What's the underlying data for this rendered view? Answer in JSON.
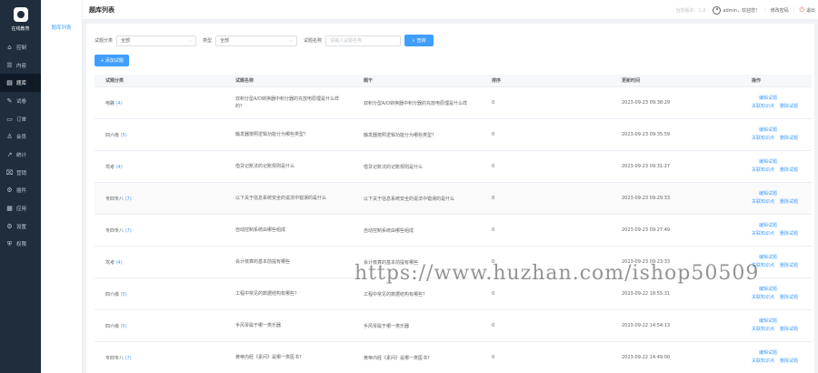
{
  "brand": {
    "name": "在线教育",
    "logo": "logo-icon"
  },
  "sidebar": {
    "items": [
      {
        "label": "控制",
        "icon": "home-icon",
        "glyph": "⌂"
      },
      {
        "label": "内容",
        "icon": "list-icon",
        "glyph": "☰"
      },
      {
        "label": "题库",
        "icon": "book-icon",
        "glyph": "▤",
        "active": true
      },
      {
        "label": "试卷",
        "icon": "exam-icon",
        "glyph": "✎"
      },
      {
        "label": "订单",
        "icon": "order-icon",
        "glyph": "▭"
      },
      {
        "label": "会员",
        "icon": "user-icon",
        "glyph": "♙"
      },
      {
        "label": "统计",
        "icon": "chart-icon",
        "glyph": "↗"
      },
      {
        "label": "营销",
        "icon": "shop-icon",
        "glyph": "⌧"
      },
      {
        "label": "插件",
        "icon": "plugin-icon",
        "glyph": "⚙"
      },
      {
        "label": "应用",
        "icon": "app-icon",
        "glyph": "▦"
      },
      {
        "label": "设置",
        "icon": "settings-icon",
        "glyph": "⚙"
      },
      {
        "label": "权限",
        "icon": "shield-icon",
        "glyph": "⛨"
      }
    ]
  },
  "submenu": {
    "active_item": "题库列表"
  },
  "header": {
    "title": "题库列表",
    "version": "当前版本：1.0",
    "greeting": "admin，欢迎您！",
    "change_password": "修改密码",
    "logout": "退出"
  },
  "filters": {
    "category_label": "试题分类",
    "category_value": "全部",
    "type_label": "类型",
    "type_value": "全部",
    "name_label": "试题名称",
    "name_placeholder": "请输入试题名称",
    "search_button": "查询"
  },
  "add_button": "+ 添加试题",
  "table": {
    "columns": [
      "试题分类",
      "试题名称",
      "题干",
      "排序",
      "更新时间",
      "操作"
    ],
    "ops": {
      "edit": "编辑试题",
      "related": "关联知识点",
      "delete": "删除试题"
    },
    "rows": [
      {
        "category": "电路",
        "count": "(4)",
        "name": "双积分型A/D转换器中积分器的充放电原理是什么样的？",
        "stem": "双积分型A/D转换器中积分器的充放电原理是什么样",
        "sort": "0",
        "time": "2023-09-23 09:38:29"
      },
      {
        "category": "四六级",
        "count": "(5)",
        "name": "触发器按照逻辑功能分为哪些类型？",
        "stem": "触发器按照逻辑功能分为哪些类型？",
        "sort": "0",
        "time": "2023-09-23 09:35:59"
      },
      {
        "category": "驾考",
        "count": "(4)",
        "name": "借贷记账法的记账规则是什么",
        "stem": "借贷记账法的记账规则是什么",
        "sort": "0",
        "time": "2023-09-23 09:31:27"
      },
      {
        "category": "专四专八",
        "count": "(7)",
        "name": "以下关于信息系统安全的说法中错误的是什么",
        "stem": "以下关于信息系统安全的说法中错误的是什么",
        "sort": "0",
        "time": "2023-09-23 09:29:33"
      },
      {
        "category": "专四专八",
        "count": "(7)",
        "name": "自动控制系统由哪些组成",
        "stem": "自动控制系统由哪些组成",
        "sort": "0",
        "time": "2023-09-23 09:27:49"
      },
      {
        "category": "驾考",
        "count": "(4)",
        "name": "会计核算的基本前提有哪些",
        "stem": "会计核算的基本前提有哪些",
        "sort": "0",
        "time": "2023-09-23 09:23:33"
      },
      {
        "category": "四六级",
        "count": "(5)",
        "name": "工程中常见的数据结构有哪些？",
        "stem": "工程中常见的数据结构有哪些？",
        "sort": "0",
        "time": "2023-09-22 18:55:31"
      },
      {
        "category": "四六级",
        "count": "(5)",
        "name": "手风琴属于哪一类乐器",
        "stem": "手风琴属于哪一类乐器",
        "sort": "0",
        "time": "2023-09-22 14:54:13"
      },
      {
        "category": "专四专八",
        "count": "(7)",
        "name": "黄帝内经《素问》是哪一类医书？",
        "stem": "黄帝内经《素问》是哪一类医书？",
        "sort": "0",
        "time": "2023-09-22 14:49:00"
      }
    ]
  },
  "watermark": "https://www.huzhan.com/ishop50509"
}
